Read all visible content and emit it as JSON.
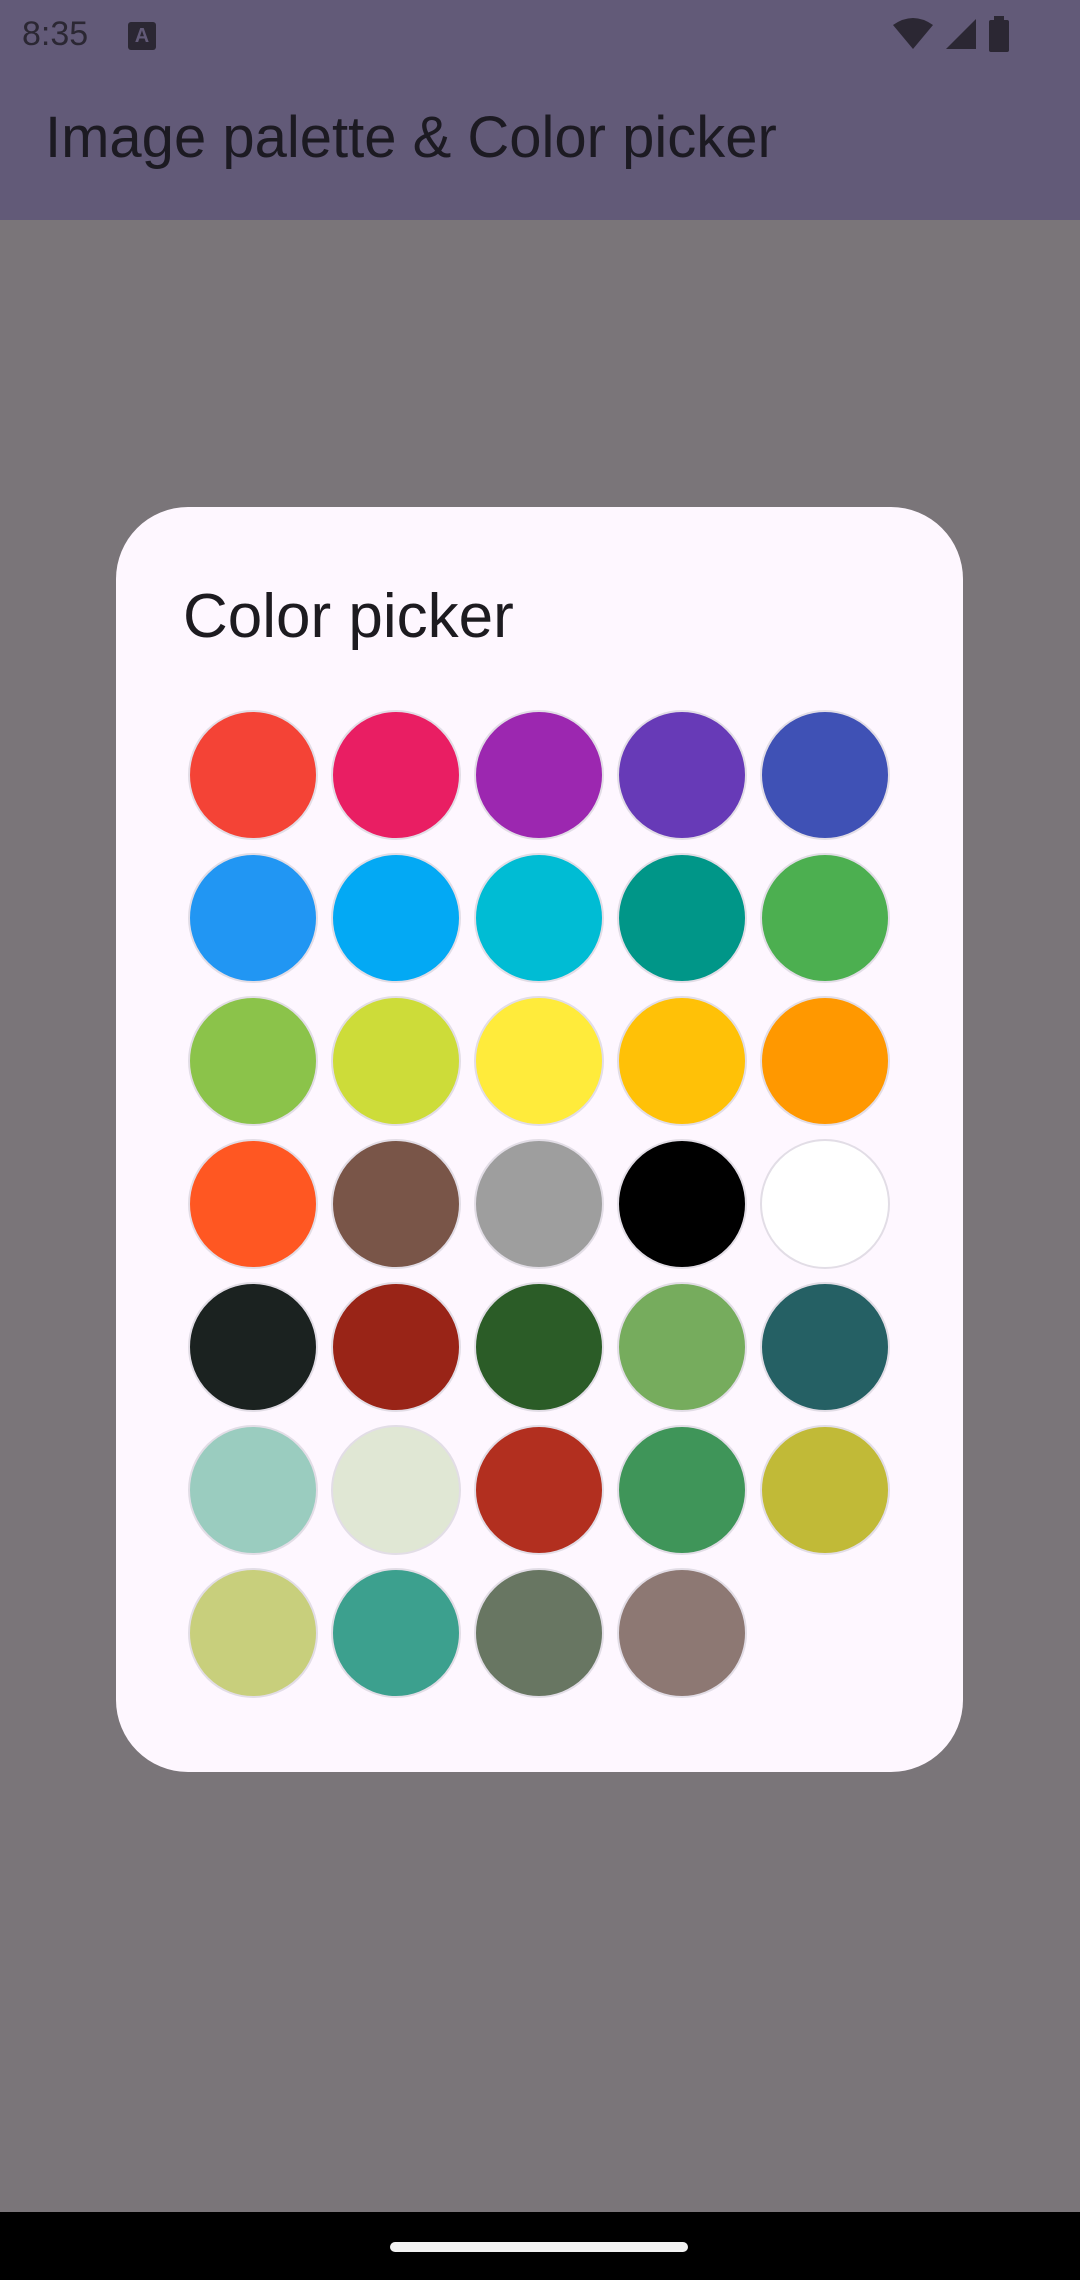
{
  "status_bar": {
    "time": "8:35",
    "icons": [
      "a-notification-icon",
      "wifi-icon",
      "cellular-icon",
      "battery-icon"
    ]
  },
  "app_bar": {
    "title": "Image palette & Color picker",
    "color": "#625A78"
  },
  "dialog": {
    "title": "Color picker",
    "colors": [
      "#F44336",
      "#E91E63",
      "#9C27B0",
      "#673AB7",
      "#3F51B5",
      "#2196F3",
      "#03A9F4",
      "#00BCD4",
      "#009688",
      "#4CAF50",
      "#8BC34A",
      "#CDDC39",
      "#FFEB3B",
      "#FFC107",
      "#FF9800",
      "#FF5722",
      "#795548",
      "#9E9E9E",
      "#000000",
      "#FFFFFF",
      "#1B2220",
      "#992417",
      "#2B5C27",
      "#76AC5D",
      "#256064",
      "#9ACCBF",
      "#E0E7D4",
      "#B22F1F",
      "#3F9559",
      "#C1BA37",
      "#C8CF7C",
      "#3CA08E",
      "#687662",
      "#8D7873"
    ]
  }
}
